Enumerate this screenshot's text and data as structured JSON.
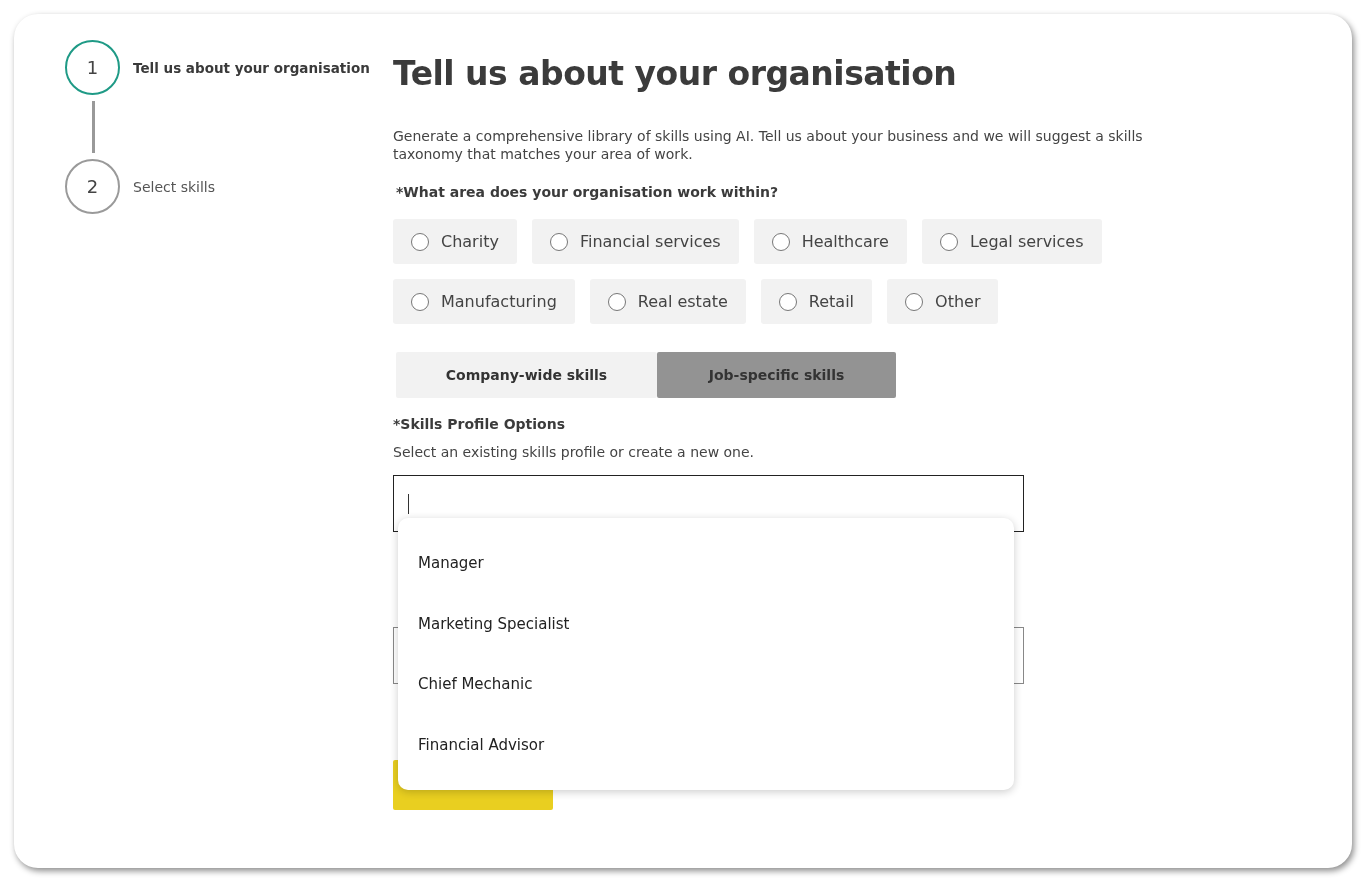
{
  "steps": [
    {
      "number": "1",
      "label": "Tell us about your organisation",
      "selected": true
    },
    {
      "number": "2",
      "label": "Select skills",
      "selected": false
    }
  ],
  "title": "Tell us about your organisation",
  "intro": "Generate a comprehensive library of skills using AI. Tell us about your business and we will suggest a skills taxonomy that matches your area of work.",
  "area_question": "*What area does your organisation work within?",
  "areas": [
    {
      "label": "Charity",
      "selected": false
    },
    {
      "label": "Financial services",
      "selected": false
    },
    {
      "label": "Healthcare",
      "selected": false
    },
    {
      "label": "Legal services",
      "selected": false
    },
    {
      "label": "Manufacturing",
      "selected": false
    },
    {
      "label": "Real estate",
      "selected": false
    },
    {
      "label": "Retail",
      "selected": false
    },
    {
      "label": "Other",
      "selected": false
    }
  ],
  "tabs": [
    {
      "label": "Company-wide skills",
      "selected": false
    },
    {
      "label": "Job-specific skills",
      "selected": true
    }
  ],
  "profile_label": "*Skills Profile Options",
  "profile_hint": "Select an existing skills profile or create a new one.",
  "profile_menu": [
    {
      "label": "Manager"
    },
    {
      "label": "Marketing Specialist"
    },
    {
      "label": "Chief Mechanic"
    },
    {
      "label": "Financial Advisor"
    }
  ]
}
